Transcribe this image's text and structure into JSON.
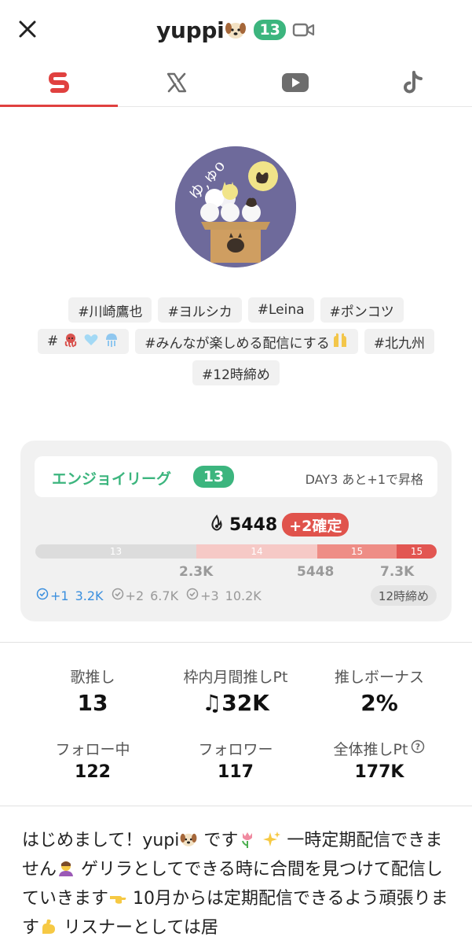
{
  "header": {
    "title": "yuppi",
    "level_badge": "13"
  },
  "tabs": [
    {
      "id": "showroom",
      "icon": "showroom-icon",
      "active": true
    },
    {
      "id": "x",
      "icon": "x-icon",
      "active": false
    },
    {
      "id": "youtube",
      "icon": "youtube-icon",
      "active": false
    },
    {
      "id": "tiktok",
      "icon": "tiktok-icon",
      "active": false
    }
  ],
  "tags": {
    "t1": "#川崎鷹也",
    "t2": "#ヨルシカ",
    "t3": "#Leina",
    "t4": "#ポンコツ",
    "t5": "#",
    "t6": "#みんなが楽しめる配信にする",
    "t7": "#北九州",
    "t8": "#12時締め"
  },
  "league": {
    "name": "エンジョイリーグ",
    "badge": "13",
    "day_text": "DAY3 あと+1で昇格",
    "score": "5448",
    "confirm": "+2確定",
    "segments": {
      "s13": "13",
      "s14": "14",
      "s15a": "15",
      "s15b": "15"
    },
    "thresholds": {
      "t1": "2.3K",
      "t2": "5448",
      "t3": "7.3K"
    },
    "boosts": {
      "b1_label": "+1",
      "b1_value": "3.2K",
      "b2_label": "+2",
      "b2_value": "6.7K",
      "b3_label": "+3",
      "b3_value": "10.2K"
    },
    "deadline": "12時締め"
  },
  "stats": {
    "song_label": "歌推し",
    "song_value": "13",
    "monthly_label": "枠内月間推しPt",
    "monthly_value": "♫32K",
    "bonus_label": "推しボーナス",
    "bonus_value": "2%",
    "following_label": "フォロー中",
    "following_value": "122",
    "followers_label": "フォロワー",
    "followers_value": "117",
    "total_label": "全体推しPt",
    "total_value": "177K"
  },
  "bio": {
    "p1": "はじめまして！yupi",
    "p2": " です",
    "p3": "  一時定期配信できません",
    "p4": "  ゲリラとしてできる時に合間を見つけて配信していきます",
    "p5": "  10月からは定期配信できるよう頑張ります",
    "p6": "  リスナーとしては居"
  },
  "colors": {
    "accent_green": "#3cb57e",
    "accent_red": "#e0413f",
    "link_blue": "#3a8fde"
  }
}
